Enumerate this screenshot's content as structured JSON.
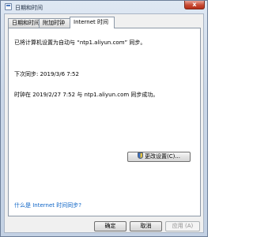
{
  "window": {
    "title": "日期和时间",
    "close_symbol": "x"
  },
  "tabs": [
    {
      "label": "日期和时间"
    },
    {
      "label": "附加时钟"
    },
    {
      "label": "Internet 时间"
    }
  ],
  "panel": {
    "sync_setting": "已将计算机设置为自动与 “ntp1.aliyun.com” 同步。",
    "next_sync": "下次同步: 2019/3/6 7:52",
    "last_sync": "时钟在 2019/2/27 7:52 与 ntp1.aliyun.com 同步成功。",
    "change_settings_label": "更改设置(C)...",
    "help_link": "什么是 Internet 时间同步?"
  },
  "footer": {
    "ok_label": "确定",
    "cancel_label": "取消",
    "apply_label": "应用 (A)"
  },
  "colors": {
    "link": "#0b63c6",
    "close_button": "#c74a33"
  },
  "icons": {
    "title": "clock-calendar-icon",
    "change_settings": "uac-shield-icon"
  }
}
